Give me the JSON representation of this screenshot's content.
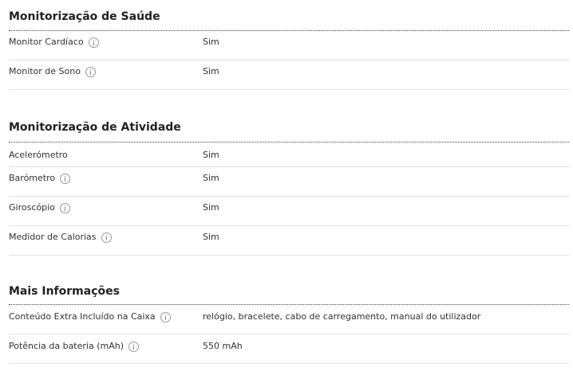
{
  "sections": [
    {
      "title": "Monitorização de Saúde",
      "rows": [
        {
          "label": "Monitor Cardíaco",
          "value": "Sim",
          "has_info": true
        },
        {
          "label": "Monitor de Sono",
          "value": "Sim",
          "has_info": true
        }
      ]
    },
    {
      "title": "Monitorização de Atividade",
      "rows": [
        {
          "label": "Acelerómetro",
          "value": "Sim",
          "has_info": false
        },
        {
          "label": "Barómetro",
          "value": "Sim",
          "has_info": true
        },
        {
          "label": "Giroscópio",
          "value": "Sim",
          "has_info": true
        },
        {
          "label": "Medidor de Calorias",
          "value": "Sim",
          "has_info": true
        }
      ]
    },
    {
      "title": "Mais Informações",
      "rows": [
        {
          "label": "Conteúdo Extra Incluído na Caixa",
          "value": "relógio, bracelete, cabo de carregamento, manual do utilizador",
          "has_info": true
        },
        {
          "label": "Potência da bateria (mAh)",
          "value": "550 mAh",
          "has_info": true
        }
      ]
    }
  ],
  "icons": {
    "info": "info-circle-icon"
  },
  "colors": {
    "divider_dotted": "#444444",
    "divider_row": "#e1e1e1",
    "text": "#333333"
  }
}
